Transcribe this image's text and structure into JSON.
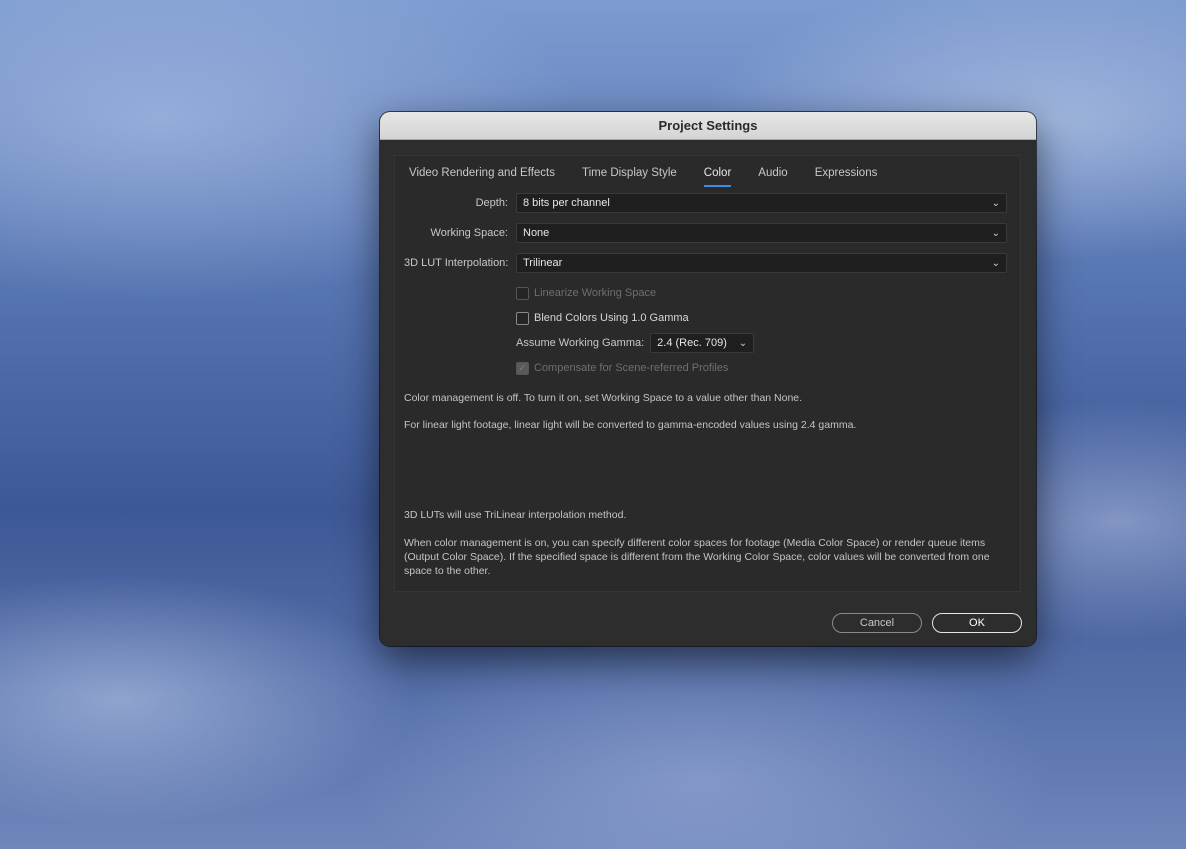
{
  "dialog": {
    "title": "Project Settings",
    "tabs": [
      {
        "label": "Video Rendering and Effects"
      },
      {
        "label": "Time Display Style"
      },
      {
        "label": "Color"
      },
      {
        "label": "Audio"
      },
      {
        "label": "Expressions"
      }
    ],
    "active_tab": "Color",
    "fields": {
      "depth": {
        "label": "Depth:",
        "value": "8 bits per channel"
      },
      "working_space": {
        "label": "Working Space:",
        "value": "None"
      },
      "lut_interpolation": {
        "label": "3D LUT Interpolation:",
        "value": "Trilinear"
      }
    },
    "checkboxes": {
      "linearize": {
        "label": "Linearize Working Space",
        "checked": false,
        "enabled": false
      },
      "blend": {
        "label": "Blend Colors Using 1.0 Gamma",
        "checked": false,
        "enabled": true
      },
      "compensate": {
        "label": "Compensate for Scene-referred Profiles",
        "checked": true,
        "enabled": false
      }
    },
    "gamma": {
      "label": "Assume Working Gamma:",
      "value": "2.4 (Rec. 709)"
    },
    "notes": {
      "color_mgmt_off": "Color management is off. To turn it on, set Working Space to a value other than None.",
      "linear_light": "For linear light footage, linear light will be converted to gamma-encoded values using 2.4 gamma.",
      "lut_method": "3D LUTs will use TriLinear interpolation method.",
      "color_mgmt_on": "When color management is on, you can specify different color spaces for footage (Media Color Space) or render queue items (Output Color Space). If the specified space is different from the Working Color Space, color values will be converted from one space to the other."
    },
    "buttons": {
      "cancel": "Cancel",
      "ok": "OK"
    }
  },
  "icons": {
    "dropdown": "chevron-down-icon",
    "check": "checkmark-icon"
  },
  "colors": {
    "tab_underline": "#3b8be8",
    "dialog_bg": "#2d2d2d"
  }
}
